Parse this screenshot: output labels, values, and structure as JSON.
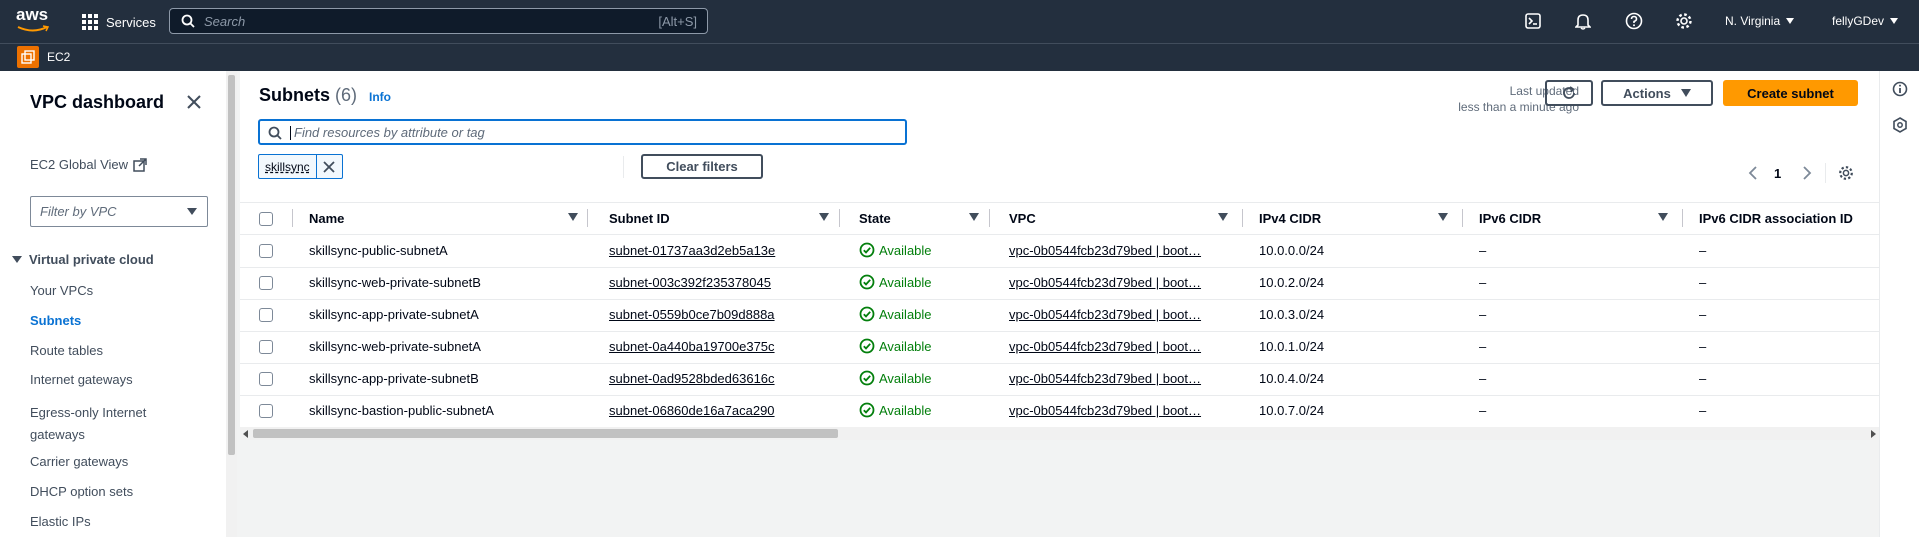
{
  "topbar": {
    "logo": "aws",
    "services_label": "Services",
    "search_placeholder": "Search",
    "search_shortcut": "[Alt+S]",
    "region": "N. Virginia",
    "account": "fellyGDev"
  },
  "service_bar": {
    "service": "EC2"
  },
  "sidebar": {
    "title": "VPC dashboard",
    "global_view": "EC2 Global View",
    "filter_placeholder": "Filter by VPC",
    "section": "Virtual private cloud",
    "items": [
      "Your VPCs",
      "Subnets",
      "Route tables",
      "Internet gateways",
      "Egress-only Internet gateways",
      "Carrier gateways",
      "DHCP option sets",
      "Elastic IPs"
    ]
  },
  "header": {
    "title": "Subnets",
    "count": "(6)",
    "info": "Info",
    "last_updated_label": "Last updated",
    "last_updated_value": "less than a minute ago",
    "actions_label": "Actions",
    "create_label": "Create subnet"
  },
  "filter": {
    "placeholder": "Find resources by attribute or tag",
    "token": "skillsync",
    "clear_label": "Clear filters"
  },
  "pagination": {
    "page": "1"
  },
  "table": {
    "columns": [
      "Name",
      "Subnet ID",
      "State",
      "VPC",
      "IPv4 CIDR",
      "IPv6 CIDR",
      "IPv6 CIDR association ID"
    ],
    "rows": [
      {
        "name": "skillsync-public-subnetA",
        "subnet_id": "subnet-01737aa3d2eb5a13e",
        "state": "Available",
        "vpc": "vpc-0b0544fcb23d79bed | boot…",
        "ipv4": "10.0.0.0/24",
        "ipv6": "–",
        "ipv6_assoc": "–"
      },
      {
        "name": "skillsync-web-private-subnetB",
        "subnet_id": "subnet-003c392f235378045",
        "state": "Available",
        "vpc": "vpc-0b0544fcb23d79bed | boot…",
        "ipv4": "10.0.2.0/24",
        "ipv6": "–",
        "ipv6_assoc": "–"
      },
      {
        "name": "skillsync-app-private-subnetA",
        "subnet_id": "subnet-0559b0ce7b09d888a",
        "state": "Available",
        "vpc": "vpc-0b0544fcb23d79bed | boot…",
        "ipv4": "10.0.3.0/24",
        "ipv6": "–",
        "ipv6_assoc": "–"
      },
      {
        "name": "skillsync-web-private-subnetA",
        "subnet_id": "subnet-0a440ba19700e375c",
        "state": "Available",
        "vpc": "vpc-0b0544fcb23d79bed | boot…",
        "ipv4": "10.0.1.0/24",
        "ipv6": "–",
        "ipv6_assoc": "–"
      },
      {
        "name": "skillsync-app-private-subnetB",
        "subnet_id": "subnet-0ad9528bded63616c",
        "state": "Available",
        "vpc": "vpc-0b0544fcb23d79bed | boot…",
        "ipv4": "10.0.4.0/24",
        "ipv6": "–",
        "ipv6_assoc": "–"
      },
      {
        "name": "skillsync-bastion-public-subnetA",
        "subnet_id": "subnet-06860de16a7aca290",
        "state": "Available",
        "vpc": "vpc-0b0544fcb23d79bed | boot…",
        "ipv4": "10.0.7.0/24",
        "ipv6": "–",
        "ipv6_assoc": "–"
      }
    ]
  },
  "colors": {
    "header_bg": "#232f3e",
    "accent_orange": "#ff9900",
    "link_blue": "#0972d3",
    "success_green": "#037f0c"
  }
}
